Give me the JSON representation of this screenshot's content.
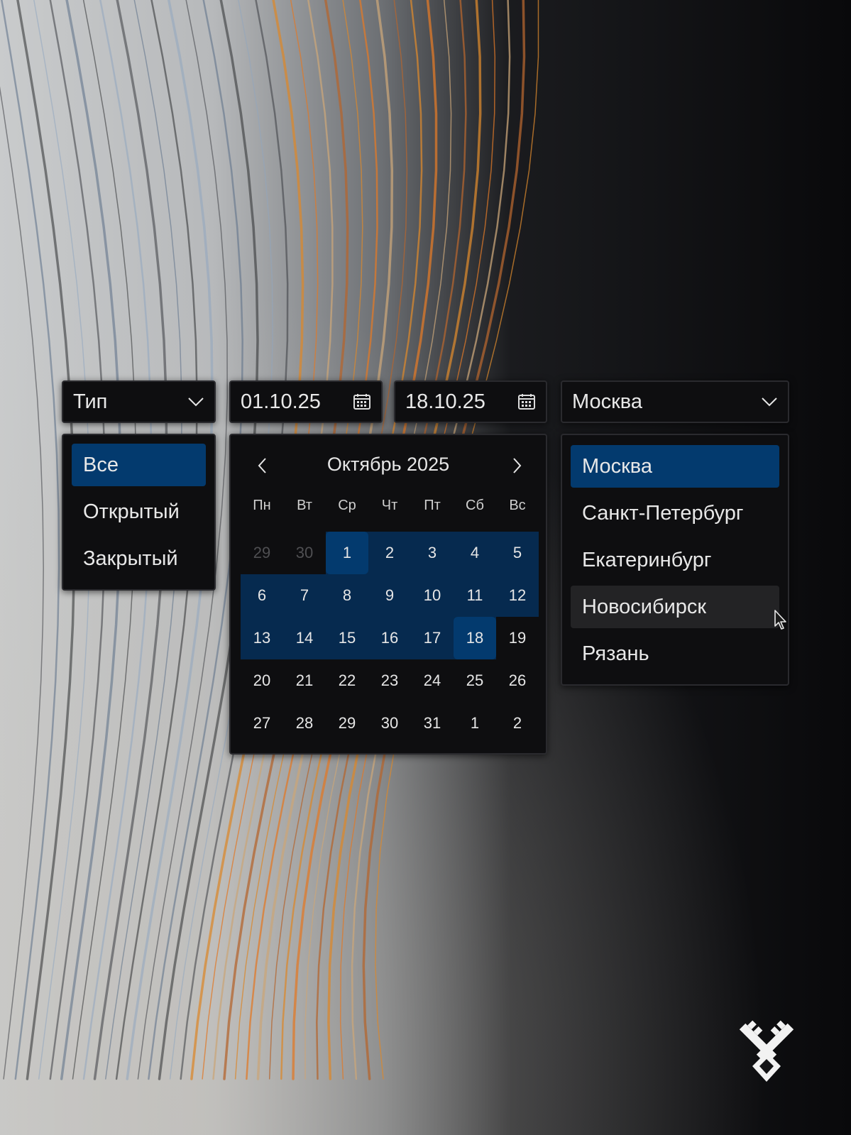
{
  "type_filter": {
    "label": "Тип",
    "options": [
      "Все",
      "Открытый",
      "Закрытый"
    ],
    "selected": "Все"
  },
  "date_range": {
    "from": "01.10.25",
    "to": "18.10.25"
  },
  "calendar": {
    "title": "Октябрь 2025",
    "weekdays": [
      "Пн",
      "Вт",
      "Ср",
      "Чт",
      "Пт",
      "Сб",
      "Вс"
    ],
    "weeks": [
      [
        "29",
        "30",
        "1",
        "2",
        "3",
        "4",
        "5"
      ],
      [
        "6",
        "7",
        "8",
        "9",
        "10",
        "11",
        "12"
      ],
      [
        "13",
        "14",
        "15",
        "16",
        "17",
        "18",
        "19"
      ],
      [
        "20",
        "21",
        "22",
        "23",
        "24",
        "25",
        "26"
      ],
      [
        "27",
        "28",
        "29",
        "30",
        "31",
        "1",
        "2"
      ]
    ],
    "range_start": "1",
    "range_end": "18"
  },
  "city_filter": {
    "value": "Москва",
    "options": [
      "Москва",
      "Санкт-Петербург",
      "Екатеринбург",
      "Новосибирск",
      "Рязань"
    ],
    "selected": "Москва",
    "hovered": "Новосибирск"
  },
  "colors": {
    "accent": "#033a6e",
    "range": "#062a4f",
    "panel": "#0e0e10"
  }
}
